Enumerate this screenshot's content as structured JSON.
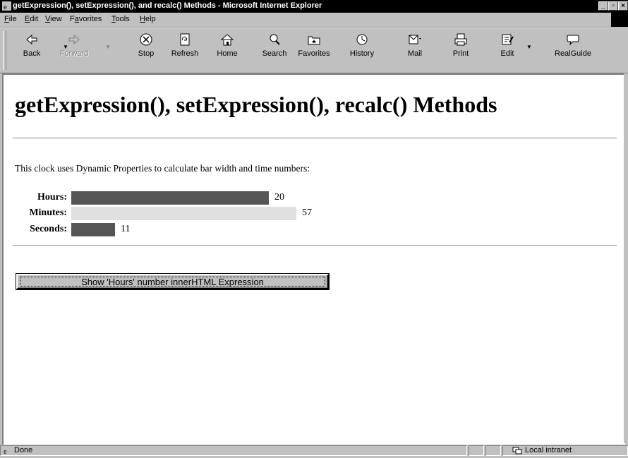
{
  "window": {
    "title": "getExpression(), setExpression(), and recalc() Methods - Microsoft Internet Explorer",
    "controls": [
      "minimize",
      "maximize",
      "close"
    ]
  },
  "menu": [
    {
      "label": "File",
      "accel": "F",
      "rest": "ile"
    },
    {
      "label": "Edit",
      "accel": "E",
      "rest": "dit"
    },
    {
      "label": "View",
      "accel": "V",
      "rest": "iew"
    },
    {
      "label": "Favorites",
      "accel": "a",
      "pre": "F",
      "rest": "vorites"
    },
    {
      "label": "Tools",
      "accel": "T",
      "rest": "ools"
    },
    {
      "label": "Help",
      "accel": "H",
      "rest": "elp"
    }
  ],
  "toolbar": {
    "back": "Back",
    "forward": "Forward",
    "stop": "Stop",
    "refresh": "Refresh",
    "home": "Home",
    "search": "Search",
    "favorites": "Favorites",
    "history": "History",
    "mail": "Mail",
    "print": "Print",
    "edit": "Edit",
    "realguide": "RealGuide"
  },
  "page": {
    "heading": "getExpression(), setExpression(), recalc() Methods",
    "intro": "This clock uses Dynamic Properties to calculate bar width and time numbers:",
    "clock": [
      {
        "label": "Hours:",
        "value": "20",
        "fraction": 0.8333,
        "color": "#555555"
      },
      {
        "label": "Minutes:",
        "value": "57",
        "fraction": 0.95,
        "color": "#e0e0e0"
      },
      {
        "label": "Seconds:",
        "value": "11",
        "fraction": 0.1833,
        "color": "#555555"
      }
    ],
    "button": "Show 'Hours' number innerHTML Expression"
  },
  "status": {
    "text": "Done",
    "zone": "Local intranet"
  }
}
